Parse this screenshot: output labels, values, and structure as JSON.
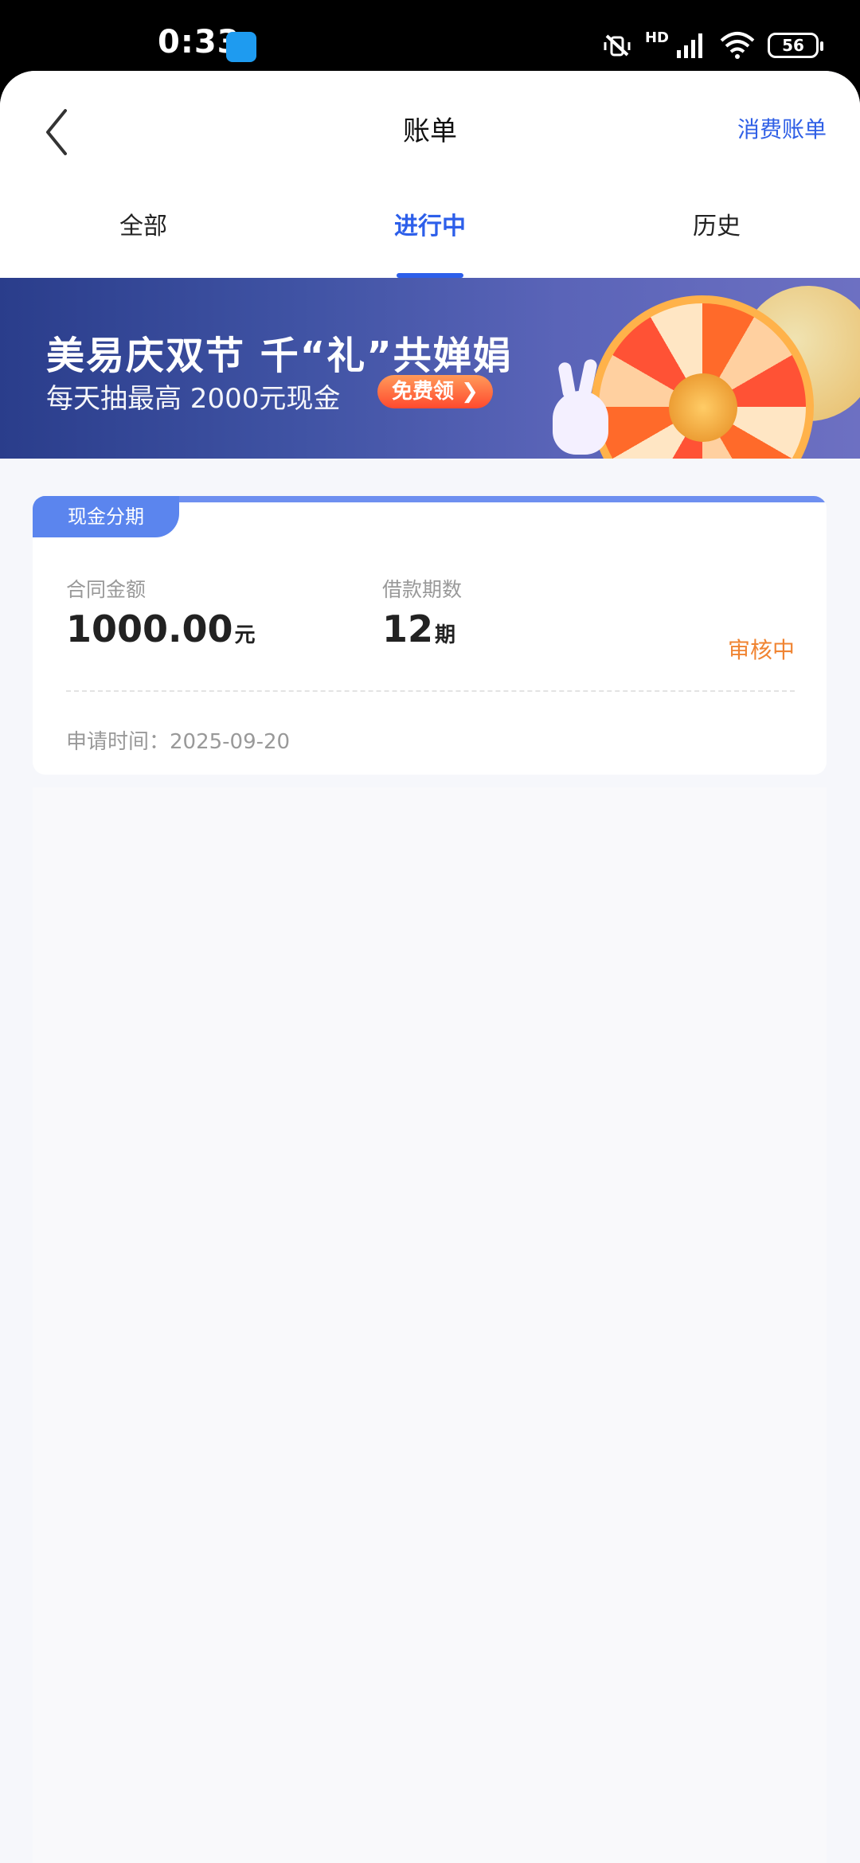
{
  "status_bar": {
    "time": "0:33",
    "network_label": "HD",
    "wifi_sub": "6",
    "battery": "56"
  },
  "nav": {
    "title": "账单",
    "right_link": "消费账单"
  },
  "tabs": [
    {
      "label": "全部",
      "active": false
    },
    {
      "label": "进行中",
      "active": true
    },
    {
      "label": "历史",
      "active": false
    }
  ],
  "banner": {
    "title": "美易庆双节 千“礼”共婵娟",
    "subtitle": "每天抽最高 2000元现金",
    "cta": "免费领"
  },
  "card": {
    "tag": "现金分期",
    "amount_label": "合同金额",
    "amount_value": "1000.00",
    "amount_unit": "元",
    "term_label": "借款期数",
    "term_value": "12",
    "term_unit": "期",
    "status": "审核中",
    "apply_time": "申请时间：2025-09-20"
  },
  "colors": {
    "accent": "#2d5fea",
    "tag": "#5b85ee",
    "status": "#f08432"
  }
}
